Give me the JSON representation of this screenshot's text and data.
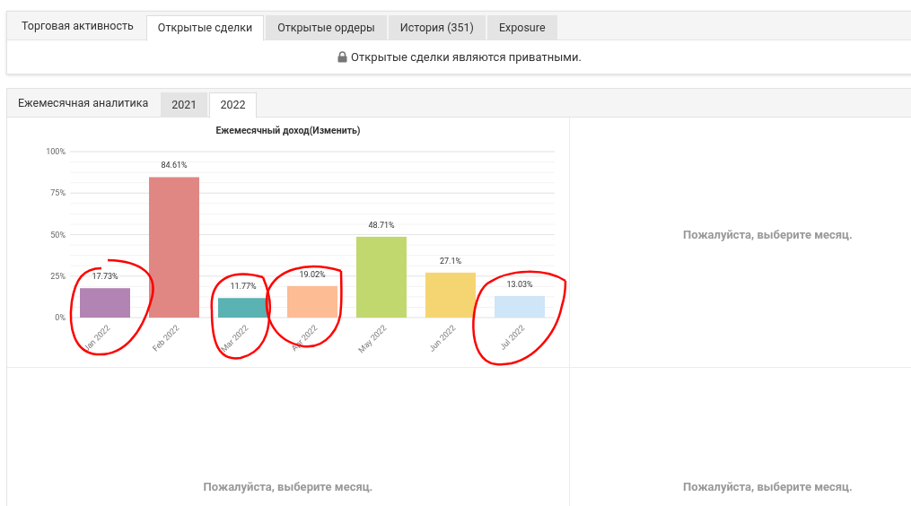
{
  "top_panel": {
    "tabs": [
      {
        "label": "Торговая активность",
        "kind": "label",
        "selected": false
      },
      {
        "label": "Открытые сделки",
        "kind": "tab",
        "selected": true
      },
      {
        "label": "Открытые ордеры",
        "kind": "tab",
        "selected": false
      },
      {
        "label": "История (351)",
        "kind": "tab",
        "selected": false
      },
      {
        "label": "Exposure",
        "kind": "tab",
        "selected": false
      }
    ],
    "notice": "Открытые сделки являются приватными."
  },
  "analytics": {
    "title": "Ежемесячная аналитика",
    "year_tabs": [
      {
        "label": "2021",
        "selected": false
      },
      {
        "label": "2022",
        "selected": true
      }
    ],
    "chart": {
      "chart_data": {
        "type": "bar",
        "title": "Ежемесячный доход(Изменить)",
        "categories": [
          "Jan 2022",
          "Feb 2022",
          "Mar 2022",
          "Apr 2022",
          "May 2022",
          "Jun 2022",
          "Jul 2022"
        ],
        "values": [
          17.73,
          84.61,
          11.77,
          19.02,
          48.71,
          27.1,
          13.03
        ],
        "colors": [
          "#b284b3",
          "#e08784",
          "#5ab2b2",
          "#fdbc94",
          "#c0d86d",
          "#f5d572",
          "#cfe5f8"
        ],
        "value_labels": [
          "17.73%",
          "84.61%",
          "11.77%",
          "19.02%",
          "48.71%",
          "27.1%",
          "13.03%"
        ],
        "ylim": [
          0,
          100
        ],
        "grid": true,
        "yticks": [
          {
            "value": 0,
            "label": "0%"
          },
          {
            "value": 25,
            "label": "25%"
          },
          {
            "value": 50,
            "label": "50%"
          },
          {
            "value": 75,
            "label": "75%"
          },
          {
            "value": 100,
            "label": "100%"
          }
        ]
      }
    },
    "empty_panels": [
      {
        "text": "Пожалуйста, выберите месяц."
      },
      {
        "text": "Пожалуйста, выберите месяц."
      },
      {
        "text": "Пожалуйста, выберите месяц."
      }
    ]
  }
}
